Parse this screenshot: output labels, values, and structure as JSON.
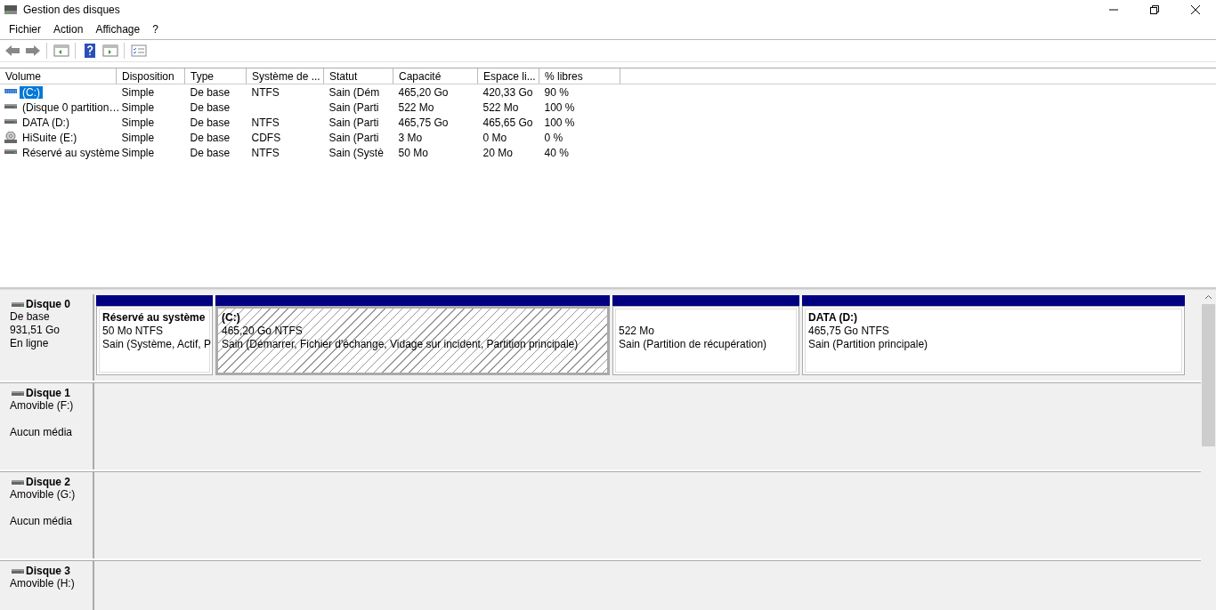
{
  "window": {
    "title": "Gestion des disques"
  },
  "menu": [
    "Fichier",
    "Action",
    "Affichage",
    "?"
  ],
  "volume_table": {
    "columns": [
      "Volume",
      "Disposition",
      "Type",
      "Système de ...",
      "Statut",
      "Capacité",
      "Espace li...",
      "% libres"
    ],
    "rows": [
      {
        "kind": "striped",
        "selected": true,
        "cells": [
          "(C:)",
          "Simple",
          "De base",
          "NTFS",
          "Sain (Dém",
          "465,20 Go",
          "420,33 Go",
          "90 %"
        ]
      },
      {
        "kind": "disk",
        "selected": false,
        "cells": [
          "(Disque 0 partition…",
          "Simple",
          "De base",
          "",
          "Sain (Parti",
          "522 Mo",
          "522 Mo",
          "100 %"
        ]
      },
      {
        "kind": "disk",
        "selected": false,
        "cells": [
          "DATA (D:)",
          "Simple",
          "De base",
          "NTFS",
          "Sain (Parti",
          "465,75 Go",
          "465,65 Go",
          "100 %"
        ]
      },
      {
        "kind": "cd",
        "selected": false,
        "cells": [
          "HiSuite (E:)",
          "Simple",
          "De base",
          "CDFS",
          "Sain (Parti",
          "3 Mo",
          "0 Mo",
          "0 %"
        ]
      },
      {
        "kind": "disk",
        "selected": false,
        "cells": [
          "Réservé au système",
          "Simple",
          "De base",
          "NTFS",
          "Sain (Systè",
          "50 Mo",
          "20 Mo",
          "40 %"
        ]
      }
    ]
  },
  "disks": [
    {
      "name": "Disque 0",
      "type": "De base",
      "size": "931,51 Go",
      "status": "En ligne",
      "partitions": [
        {
          "name": "Réservé au système",
          "size": "50 Mo NTFS",
          "status": "Sain (Système, Actif, P",
          "selected": false
        },
        {
          "name": "(C:)",
          "size": "465,20 Go NTFS",
          "status": "Sain (Démarrer, Fichier d'échange, Vidage sur incident, Partition principale)",
          "selected": true
        },
        {
          "size": "522 Mo",
          "status": "Sain (Partition de récupération)",
          "selected": false
        },
        {
          "name": "DATA  (D:)",
          "size": "465,75 Go NTFS",
          "status": "Sain (Partition principale)",
          "selected": false
        }
      ]
    },
    {
      "name": "Disque 1",
      "type": "Amovible (F:)",
      "status": "Aucun média"
    },
    {
      "name": "Disque 2",
      "type": "Amovible (G:)",
      "status": "Aucun média"
    },
    {
      "name": "Disque 3",
      "type": "Amovible (H:)"
    }
  ]
}
